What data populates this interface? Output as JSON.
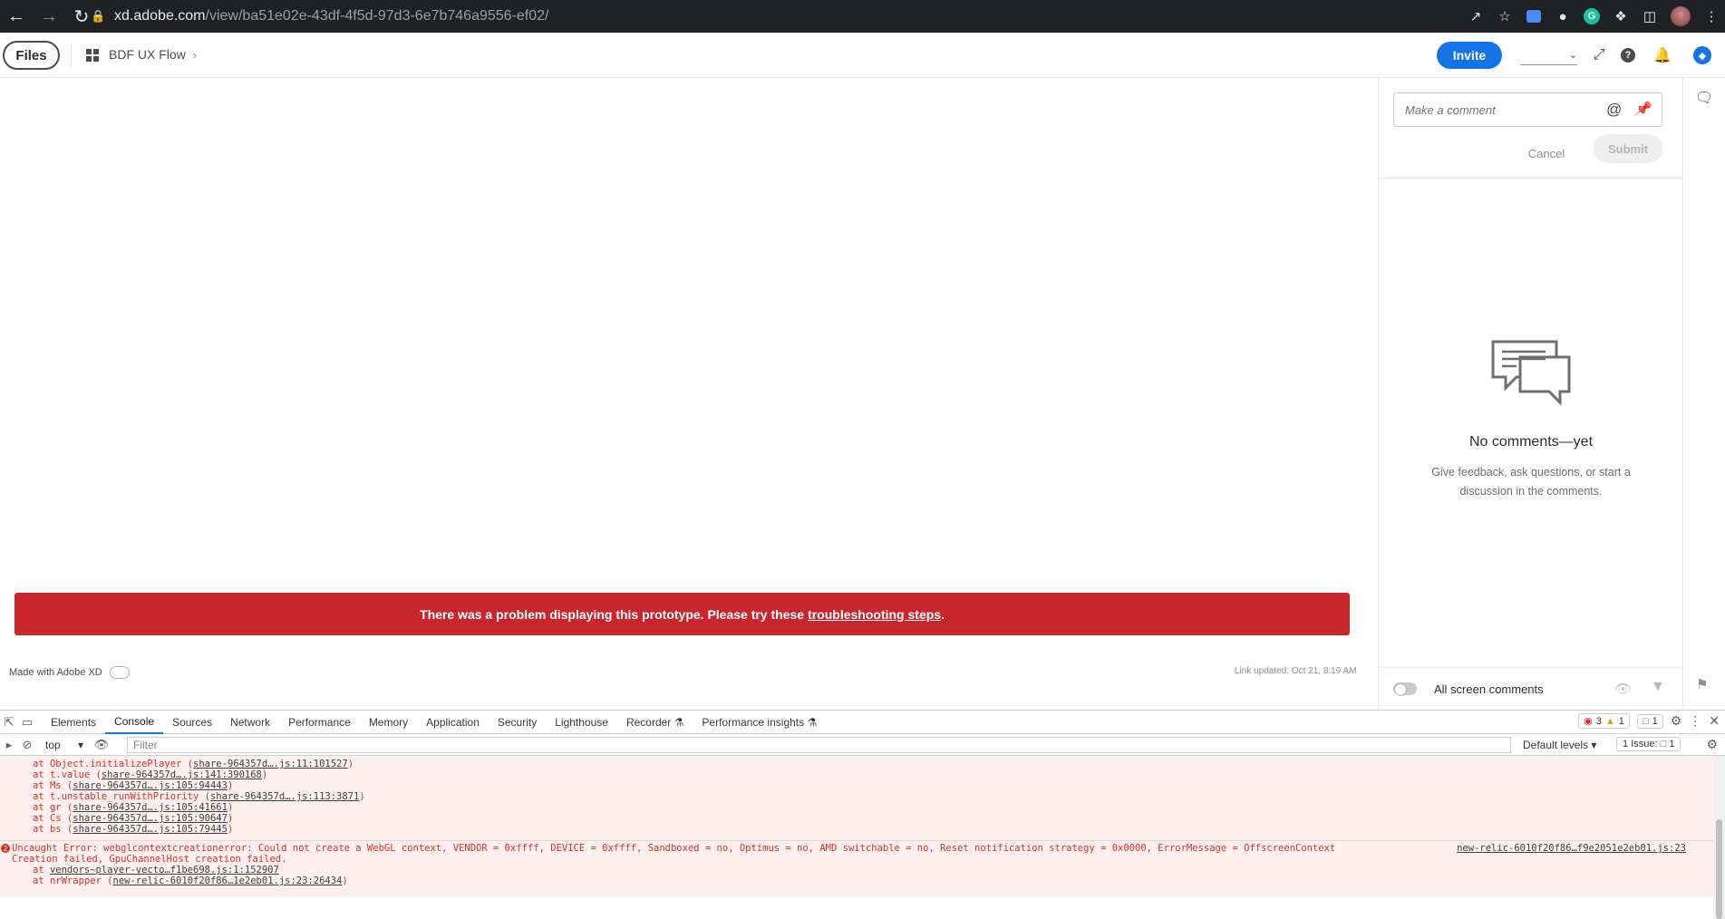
{
  "browser": {
    "url_host": "xd.adobe.com",
    "url_path": "/view/ba51e02e-43df-4f5d-97d3-6e7b746a9556-ef02/"
  },
  "header": {
    "files_label": "Files",
    "breadcrumb": "BDF UX Flow",
    "invite_label": "Invite",
    "zoom_value": ""
  },
  "canvas": {
    "error_text": "There was a problem displaying this prototype. Please try these",
    "error_link": "troubleshooting steps",
    "error_end": ".",
    "made_with": "Made with Adobe XD",
    "link_updated": "Link updated: Oct 21, 8:19 AM"
  },
  "comments": {
    "input_placeholder": "Make a comment",
    "cancel_label": "Cancel",
    "submit_label": "Submit",
    "empty_title": "No comments—yet",
    "empty_subtitle": "Give feedback, ask questions, or start a discussion in the comments.",
    "all_screen_label": "All screen comments"
  },
  "devtools": {
    "tabs": [
      "Elements",
      "Console",
      "Sources",
      "Network",
      "Performance",
      "Memory",
      "Application",
      "Security",
      "Lighthouse",
      "Recorder ⚗",
      "Performance insights ⚗"
    ],
    "active_tab": "Console",
    "error_count": "3",
    "warning_count": "1",
    "message_count": "1",
    "context": "top",
    "filter_placeholder": "Filter",
    "levels_label": "Default levels ▾",
    "issues_label": "1 Issue:",
    "issues_count": "1",
    "stack1": [
      {
        "fn": "at Object.initializePlayer (",
        "link": "share-964357d….js:11:101527",
        "end": ")"
      },
      {
        "fn": "at t.value (",
        "link": "share-964357d….js:141:390168",
        "end": ")"
      },
      {
        "fn": "at Ms (",
        "link": "share-964357d….js:105:94443",
        "end": ")"
      },
      {
        "fn": "at t.unstable_runWithPriority (",
        "link": "share-964357d….js:113:3871",
        "end": ")"
      },
      {
        "fn": "at gr (",
        "link": "share-964357d….js:105:41661",
        "end": ")"
      },
      {
        "fn": "at Cs (",
        "link": "share-964357d….js:105:90647",
        "end": ")"
      },
      {
        "fn": "at bs (",
        "link": "share-964357d….js:105:79445",
        "end": ")"
      }
    ],
    "error2_count": "2",
    "error2_line1": "Uncaught Error: webglcontextcreationerror: Could not create a WebGL context, VENDOR = 0xffff, DEVICE = 0xffff, Sandboxed = no, Optimus = no, AMD switchable = no, Reset notification strategy = 0x0000, ErrorMessage = OffscreenContext",
    "error2_line2": "Creation failed, GpuChannelHost creation failed.",
    "error2_source": "new-relic-6010f20f86…f9e2051e2eb01.js:23",
    "stack2": [
      {
        "fn": "at ",
        "link": "vendors~player-vecto…f1be698.js:1:152907",
        "end": ""
      },
      {
        "fn": "at nrWrapper (",
        "link": "new-relic-6010f20f86…1e2eb01.js:23:26434",
        "end": ")"
      }
    ]
  }
}
